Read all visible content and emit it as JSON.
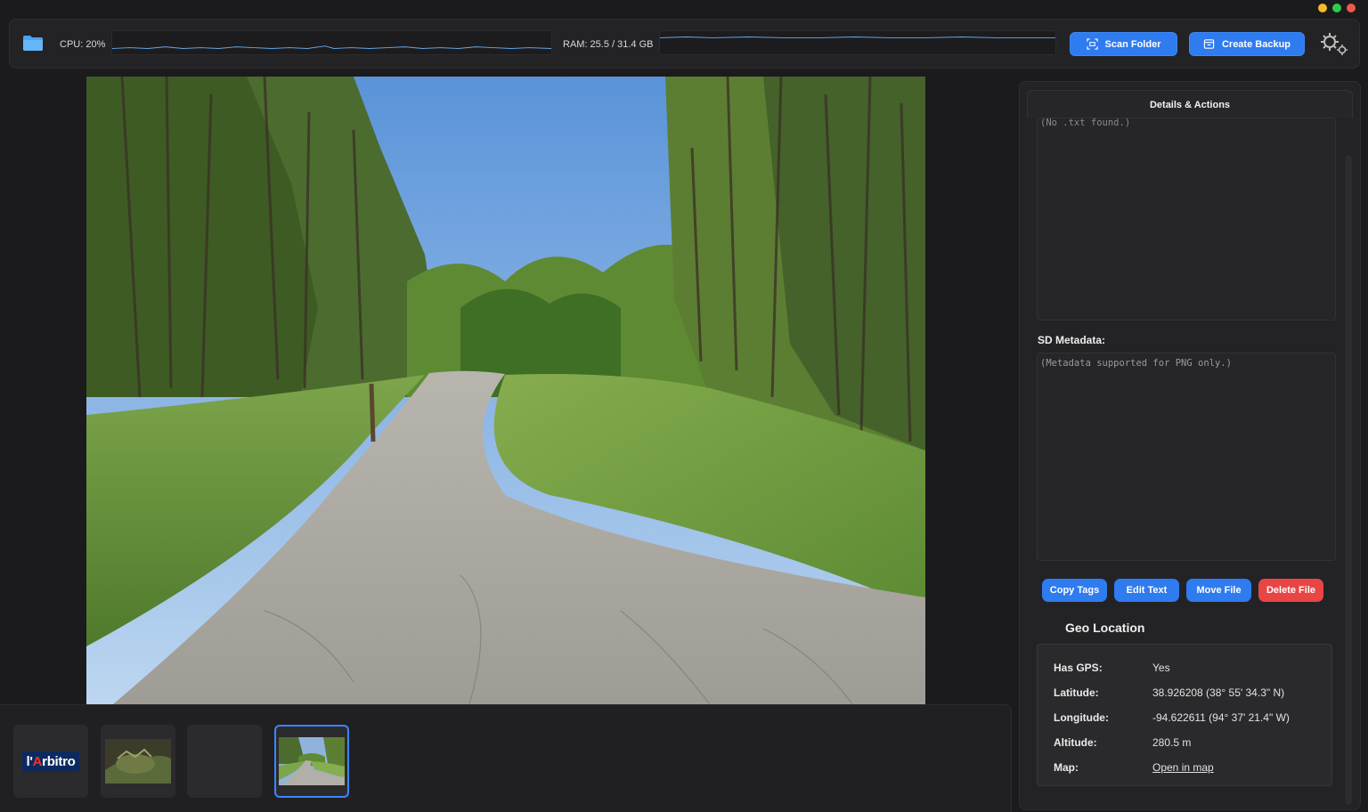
{
  "toolbar": {
    "cpu_label": "CPU: 20%",
    "ram_label": "RAM: 25.5 / 31.4 GB",
    "scan_label": "Scan Folder",
    "backup_label": "Create Backup",
    "accent_color": "#2f7bf0"
  },
  "icons": {
    "folder": "folder-icon",
    "scan": "scan-icon",
    "backup": "backup-icon",
    "settings": "gear-icon"
  },
  "thumbnails": {
    "items": [
      {
        "type": "logo",
        "text_main": "l'",
        "text_accent": "A",
        "text_rest": "rbitro"
      },
      {
        "type": "image",
        "subject": "iguana"
      },
      {
        "type": "empty"
      },
      {
        "type": "image",
        "subject": "forest path",
        "selected": true
      }
    ]
  },
  "sidebar": {
    "tab_label": "Details & Actions",
    "txt_content": "(No .txt found.)",
    "sd_label": "SD Metadata:",
    "sd_content": "(Metadata supported for PNG only.)",
    "actions": {
      "copy": "Copy Tags",
      "edit": "Edit Text",
      "move": "Move File",
      "delete": "Delete File"
    },
    "geo": {
      "title": "Geo Location",
      "rows": [
        {
          "key": "Has GPS:",
          "value": "Yes"
        },
        {
          "key": "Latitude:",
          "value": "38.926208  (38° 55' 34.3\" N)"
        },
        {
          "key": "Longitude:",
          "value": "-94.622611  (94° 37' 21.4\" W)"
        },
        {
          "key": "Altitude:",
          "value": "280.5 m"
        },
        {
          "key": "Map:",
          "value": "Open in map"
        }
      ]
    }
  }
}
